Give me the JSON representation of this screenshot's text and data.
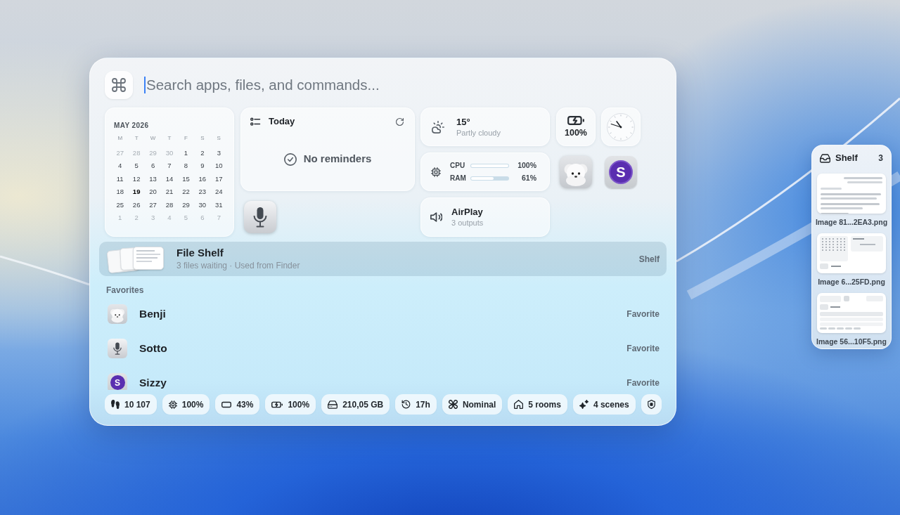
{
  "search": {
    "placeholder": "Search apps, files, and commands..."
  },
  "calendar": {
    "title": "MAY 2026",
    "weekdays": [
      "M",
      "T",
      "W",
      "T",
      "F",
      "S",
      "S"
    ],
    "days": [
      {
        "label": "27",
        "other_month": true,
        "today": false
      },
      {
        "label": "28",
        "other_month": true,
        "today": false
      },
      {
        "label": "29",
        "other_month": true,
        "today": false
      },
      {
        "label": "30",
        "other_month": true,
        "today": false
      },
      {
        "label": "1",
        "other_month": false,
        "today": false
      },
      {
        "label": "2",
        "other_month": false,
        "today": false
      },
      {
        "label": "3",
        "other_month": false,
        "today": false
      },
      {
        "label": "4",
        "other_month": false,
        "today": false
      },
      {
        "label": "5",
        "other_month": false,
        "today": false
      },
      {
        "label": "6",
        "other_month": false,
        "today": false
      },
      {
        "label": "7",
        "other_month": false,
        "today": false
      },
      {
        "label": "8",
        "other_month": false,
        "today": false
      },
      {
        "label": "9",
        "other_month": false,
        "today": false
      },
      {
        "label": "10",
        "other_month": false,
        "today": false
      },
      {
        "label": "11",
        "other_month": false,
        "today": false
      },
      {
        "label": "12",
        "other_month": false,
        "today": false
      },
      {
        "label": "13",
        "other_month": false,
        "today": false
      },
      {
        "label": "14",
        "other_month": false,
        "today": false
      },
      {
        "label": "15",
        "other_month": false,
        "today": false
      },
      {
        "label": "16",
        "other_month": false,
        "today": false
      },
      {
        "label": "17",
        "other_month": false,
        "today": false
      },
      {
        "label": "18",
        "other_month": false,
        "today": false
      },
      {
        "label": "19",
        "other_month": false,
        "today": true
      },
      {
        "label": "20",
        "other_month": false,
        "today": false
      },
      {
        "label": "21",
        "other_month": false,
        "today": false
      },
      {
        "label": "22",
        "other_month": false,
        "today": false
      },
      {
        "label": "23",
        "other_month": false,
        "today": false
      },
      {
        "label": "24",
        "other_month": false,
        "today": false
      },
      {
        "label": "25",
        "other_month": false,
        "today": false
      },
      {
        "label": "26",
        "other_month": false,
        "today": false
      },
      {
        "label": "27",
        "other_month": false,
        "today": false
      },
      {
        "label": "28",
        "other_month": false,
        "today": false
      },
      {
        "label": "29",
        "other_month": false,
        "today": false
      },
      {
        "label": "30",
        "other_month": false,
        "today": false
      },
      {
        "label": "31",
        "other_month": false,
        "today": false
      },
      {
        "label": "1",
        "other_month": true,
        "today": false
      },
      {
        "label": "2",
        "other_month": true,
        "today": false
      },
      {
        "label": "3",
        "other_month": true,
        "today": false
      },
      {
        "label": "4",
        "other_month": true,
        "today": false
      },
      {
        "label": "5",
        "other_month": true,
        "today": false
      },
      {
        "label": "6",
        "other_month": true,
        "today": false
      },
      {
        "label": "7",
        "other_month": true,
        "today": false
      }
    ]
  },
  "reminders": {
    "title": "Today",
    "empty_text": "No reminders"
  },
  "weather": {
    "temperature": "15°",
    "condition": "Partly cloudy"
  },
  "system": {
    "rows": [
      {
        "label": "CPU",
        "level": 1,
        "reading": "100%"
      },
      {
        "label": "RAM",
        "level": 0.61,
        "reading": "61%"
      }
    ]
  },
  "airplay": {
    "title": "AirPlay",
    "subtitle": "3 outputs"
  },
  "battery": {
    "text": "100%",
    "charging": true
  },
  "apps": [
    {
      "kind": "mic"
    },
    {
      "kind": "dog"
    },
    {
      "kind": "letter",
      "letter": "S"
    }
  ],
  "top_result": {
    "title": "File Shelf",
    "subtitle": "3 files waiting · Used from Finder",
    "tag": "Shelf",
    "selected": true
  },
  "favorites": {
    "heading": "Favorites",
    "items": [
      {
        "kind": "dog",
        "name": "Benji",
        "tag": "Favorite",
        "selected": false
      },
      {
        "kind": "mic",
        "name": "Sotto",
        "tag": "Favorite",
        "selected": false
      },
      {
        "kind": "letter",
        "letter": "S",
        "name": "Sizzy",
        "tag": "Favorite",
        "selected": false
      }
    ]
  },
  "status_bar": [
    {
      "kind": "steps",
      "text": "10 107"
    },
    {
      "kind": "cpu",
      "text": "100%"
    },
    {
      "kind": "battery",
      "text": "43%"
    },
    {
      "kind": "battery_charging",
      "text": "100%"
    },
    {
      "kind": "disk",
      "text": "210,05 GB"
    },
    {
      "kind": "uptime",
      "text": "17h"
    },
    {
      "kind": "thermal",
      "text": "Nominal"
    },
    {
      "kind": "home",
      "text": "5 rooms"
    },
    {
      "kind": "scenes",
      "text": "4 scenes"
    },
    {
      "kind": "security"
    }
  ],
  "shelf": {
    "title": "Shelf",
    "count": "3",
    "files": [
      {
        "kind": "document",
        "name": "Image 81...2EA3.png"
      },
      {
        "kind": "calendar",
        "name": "Image 6...25FD.png"
      },
      {
        "kind": "list",
        "name": "Image 56...10F5.png"
      }
    ]
  }
}
